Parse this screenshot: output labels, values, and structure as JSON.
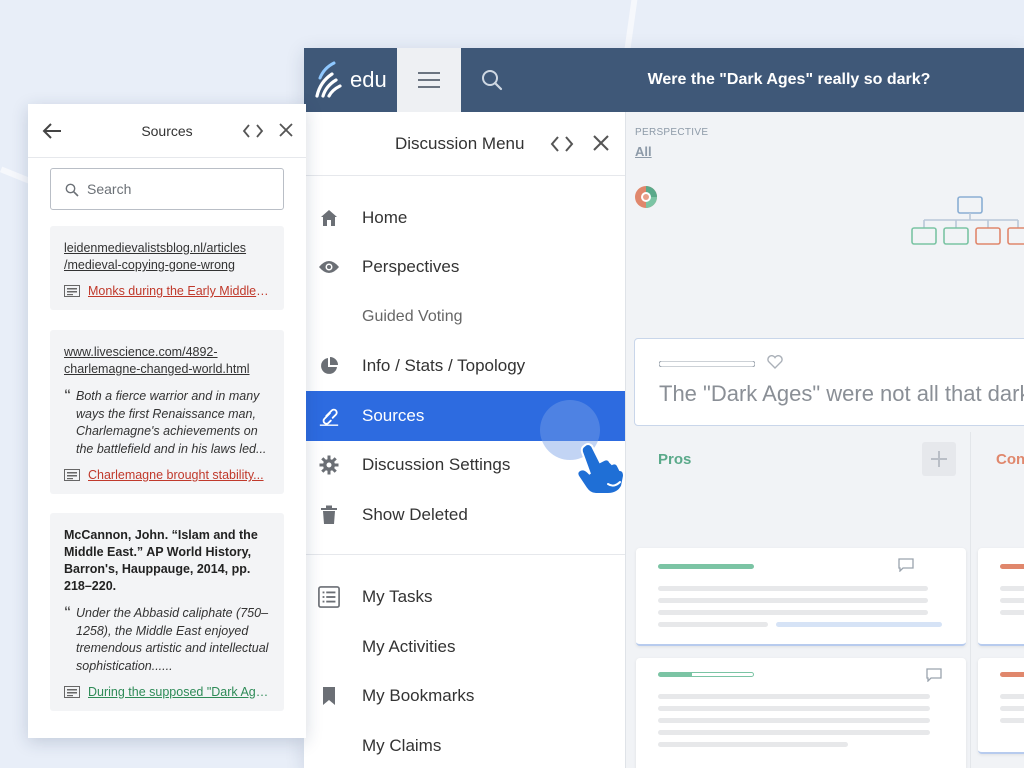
{
  "header": {
    "logo_text": "edu",
    "title": "Were the \"Dark Ages\" really so dark?"
  },
  "discussion_menu": {
    "title": "Discussion Menu",
    "items": [
      {
        "label": "Home",
        "icon": "home-icon"
      },
      {
        "label": "Perspectives",
        "icon": "eye-icon"
      },
      {
        "label": "Guided Voting",
        "icon": ""
      },
      {
        "label": "Info / Stats / Topology",
        "icon": "pie-chart-icon"
      },
      {
        "label": "Sources",
        "icon": "link-icon",
        "active": true
      },
      {
        "label": "Discussion Settings",
        "icon": "gear-icon"
      },
      {
        "label": "Show Deleted",
        "icon": "trash-icon"
      }
    ],
    "personal_items": [
      {
        "label": "My Tasks",
        "icon": "task-list-icon"
      },
      {
        "label": "My Activities",
        "icon": ""
      },
      {
        "label": "My Bookmarks",
        "icon": "bookmark-icon"
      },
      {
        "label": "My Claims",
        "icon": ""
      }
    ],
    "active_color": "#2d6be0"
  },
  "content": {
    "perspective_label": "PERSPECTIVE",
    "perspective_value": "All",
    "claim_text": "The \"Dark Ages\" were not all that dark",
    "pros_label": "Pros",
    "cons_label": "Con",
    "pros_color": "#5aa98a",
    "cons_color": "#e0876c"
  },
  "sources_panel": {
    "title": "Sources",
    "search_placeholder": "Search",
    "cards": [
      {
        "url_line1": "leidenmedievalistsblog.nl/articles",
        "url_line2": "/medieval-copying-gone-wrong",
        "linked_claim": "Monks during the Early Middle Ages...",
        "linked_claim_color": "#c0392b"
      },
      {
        "url_line1": "www.livescience.com/4892-",
        "url_line2": "charlemagne-changed-world.html",
        "quote": "Both a fierce warrior and in many ways the first Renaissance man, Charlemagne's achievements on the battlefield and in his laws led...",
        "linked_claim": "Charlemagne brought stability...",
        "linked_claim_color": "#c0392b"
      },
      {
        "reference": "McCannon, John. “Islam and the Middle East.” AP World History, Barron's, Hauppauge, 2014, pp. 218–220.",
        "quote": "Under the Abbasid caliphate (750–1258), the Middle East enjoyed tremendous artistic and intellectual sophistication......",
        "linked_claim": "During the supposed \"Dark Ages\"...",
        "linked_claim_color": "#2e8b57"
      }
    ]
  }
}
